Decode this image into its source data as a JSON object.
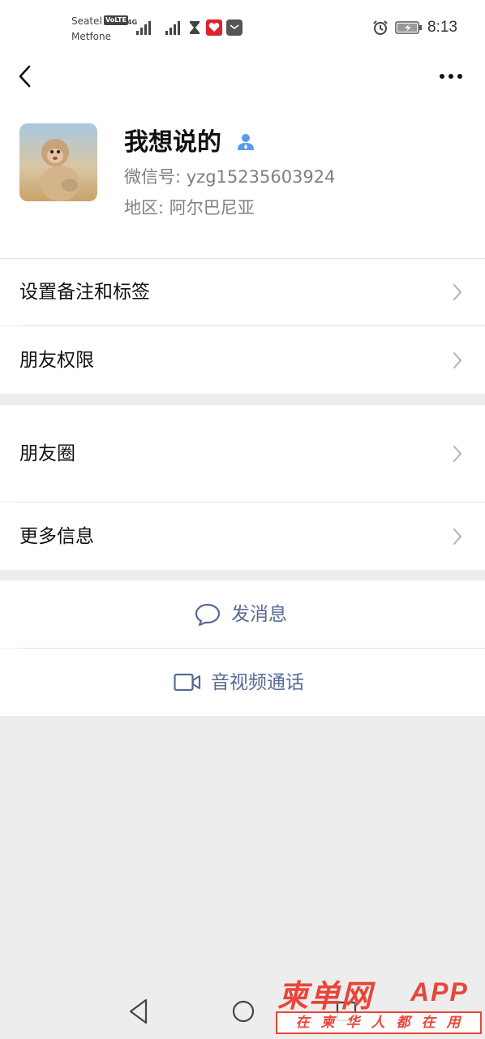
{
  "status_bar": {
    "carrier1": "Seatel",
    "carrier2": "Metfone",
    "volte": "VoLTE",
    "network": "4G",
    "time": "8:13",
    "icons": [
      "signal-icon",
      "hourglass-icon",
      "app-notification-icon",
      "message-notification-icon",
      "alarm-icon",
      "battery-icon"
    ]
  },
  "nav": {
    "back_icon": "chevron-left-icon",
    "more_icon": "more-dots-icon"
  },
  "profile": {
    "nickname": "我想说的",
    "wechat_id": "微信号: yzg15235603924",
    "region": "地区: 阿尔巴尼亚",
    "gender_icon": "male-icon",
    "accent": "#5a9be8"
  },
  "menu": {
    "items": [
      {
        "label": "设置备注和标签"
      },
      {
        "label": "朋友权限"
      },
      {
        "label": "朋友圈"
      },
      {
        "label": "更多信息"
      }
    ]
  },
  "actions": {
    "message": "发消息",
    "call": "音视频通话",
    "color": "#576b95"
  },
  "system_nav": {
    "icons": [
      "back-triangle-icon",
      "home-circle-icon",
      "recents-square-icon"
    ]
  },
  "watermark": {
    "main": "柬单网",
    "app": "APP",
    "tagline": "在柬华人都在用",
    "color": "#e8463a"
  }
}
